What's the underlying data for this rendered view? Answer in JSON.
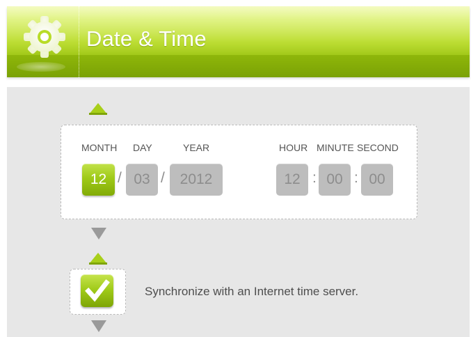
{
  "header": {
    "title": "Date & Time",
    "icon": "gear-icon"
  },
  "date": {
    "month_label": "MONTH",
    "day_label": "DAY",
    "year_label": "YEAR",
    "month": "12",
    "day": "03",
    "year": "2012",
    "separator": "/"
  },
  "time": {
    "hour_label": "HOUR",
    "minute_label": "MINUTE",
    "second_label": "SECOND",
    "hour": "12",
    "minute": "00",
    "second": "00",
    "separator": ":"
  },
  "sync": {
    "label": "Synchronize with an Internet time server.",
    "checked": true
  },
  "colors": {
    "accent": "#9fca18",
    "accent_dark": "#7ea506",
    "inactive_field": "#bdbdbd",
    "panel_bg": "#e7e7e7"
  }
}
